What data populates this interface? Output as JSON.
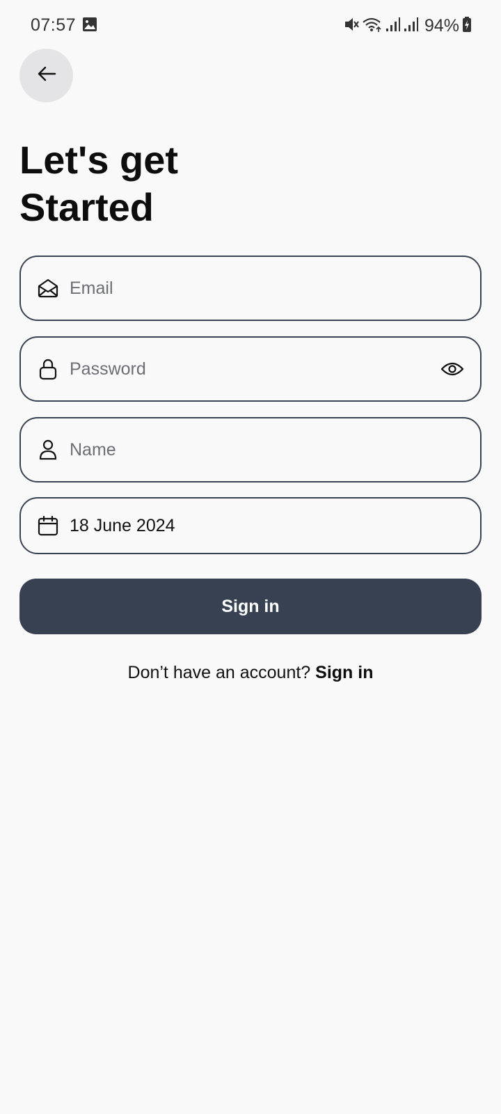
{
  "status_bar": {
    "time": "07:57",
    "battery": "94%",
    "icons": [
      "gallery-icon",
      "mute-icon",
      "wifi-icon",
      "signal-icon",
      "signal-icon",
      "battery-charging-icon"
    ]
  },
  "header": {
    "back_icon": "arrow-left-icon",
    "title_line1": "Let's get",
    "title_line2": "Started"
  },
  "form": {
    "email": {
      "placeholder": "Email",
      "value": "",
      "icon": "mail-open-icon"
    },
    "password": {
      "placeholder": "Password",
      "value": "",
      "icon": "lock-icon",
      "toggle_icon": "eye-icon"
    },
    "name": {
      "placeholder": "Name",
      "value": "",
      "icon": "user-icon"
    },
    "date": {
      "value": "18 June 2024",
      "icon": "calendar-icon"
    },
    "submit_label": "Sign in"
  },
  "footer": {
    "prompt": "Don’t have an account?",
    "link_label": "Sign in"
  },
  "colors": {
    "background": "#f9f9fa",
    "button": "#384152",
    "border": "#3a4252",
    "back_button_bg": "#e4e4e6"
  }
}
